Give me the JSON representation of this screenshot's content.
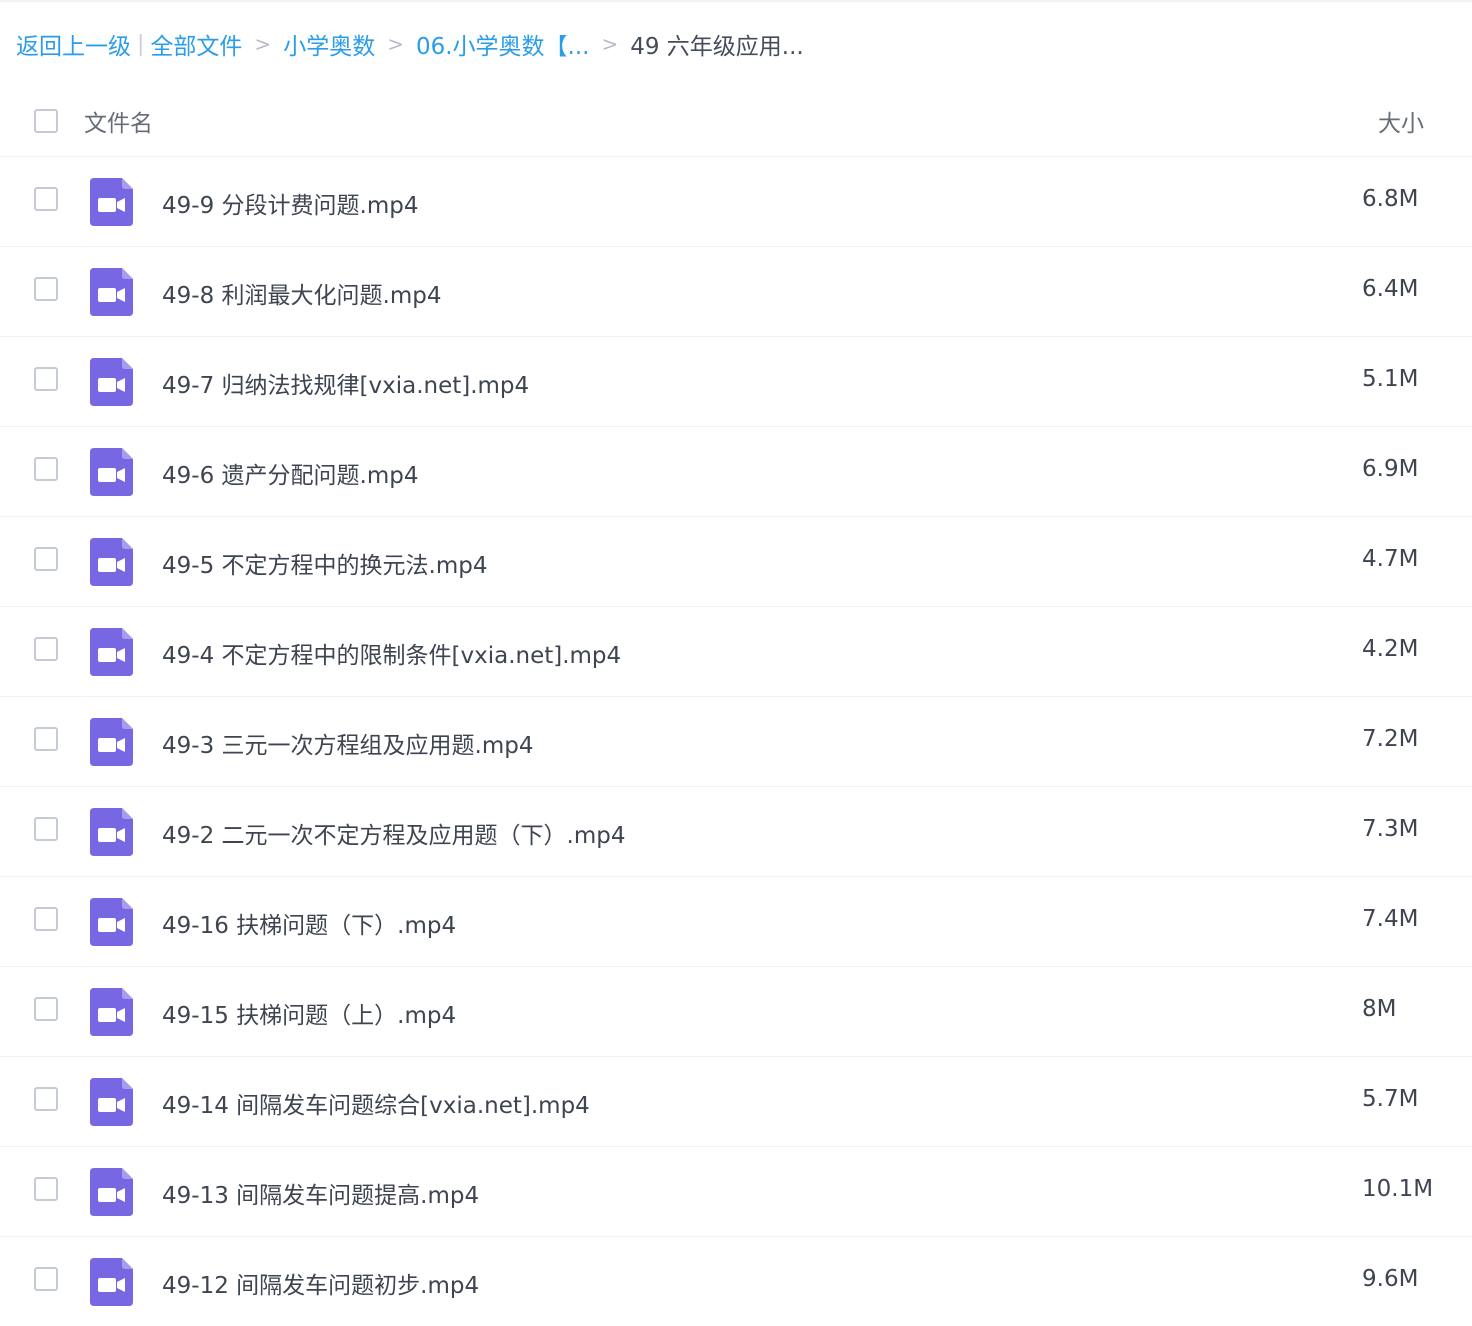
{
  "breadcrumb": {
    "back": "返回上一级",
    "pipe": "|",
    "items": [
      "全部文件",
      "小学奥数",
      "06.小学奥数【..."
    ],
    "separator": ">",
    "current": "49 六年级应用..."
  },
  "header": {
    "name_label": "文件名",
    "size_label": "大小"
  },
  "icon": {
    "name": "video-file-icon",
    "color": "#7767e3"
  },
  "files": [
    {
      "name": "49-9 分段计费问题.mp4",
      "size": "6.8M"
    },
    {
      "name": "49-8 利润最大化问题.mp4",
      "size": "6.4M"
    },
    {
      "name": "49-7 归纳法找规律[vxia.net].mp4",
      "size": "5.1M"
    },
    {
      "name": "49-6 遗产分配问题.mp4",
      "size": "6.9M"
    },
    {
      "name": "49-5 不定方程中的换元法.mp4",
      "size": "4.7M"
    },
    {
      "name": "49-4 不定方程中的限制条件[vxia.net].mp4",
      "size": "4.2M"
    },
    {
      "name": "49-3 三元一次方程组及应用题.mp4",
      "size": "7.2M"
    },
    {
      "name": "49-2 二元一次不定方程及应用题（下）.mp4",
      "size": "7.3M"
    },
    {
      "name": "49-16 扶梯问题（下）.mp4",
      "size": "7.4M"
    },
    {
      "name": "49-15 扶梯问题（上）.mp4",
      "size": "8M"
    },
    {
      "name": "49-14 间隔发车问题综合[vxia.net].mp4",
      "size": "5.7M"
    },
    {
      "name": "49-13 间隔发车问题提高.mp4",
      "size": "10.1M"
    },
    {
      "name": "49-12 间隔发车问题初步.mp4",
      "size": "9.6M"
    }
  ]
}
